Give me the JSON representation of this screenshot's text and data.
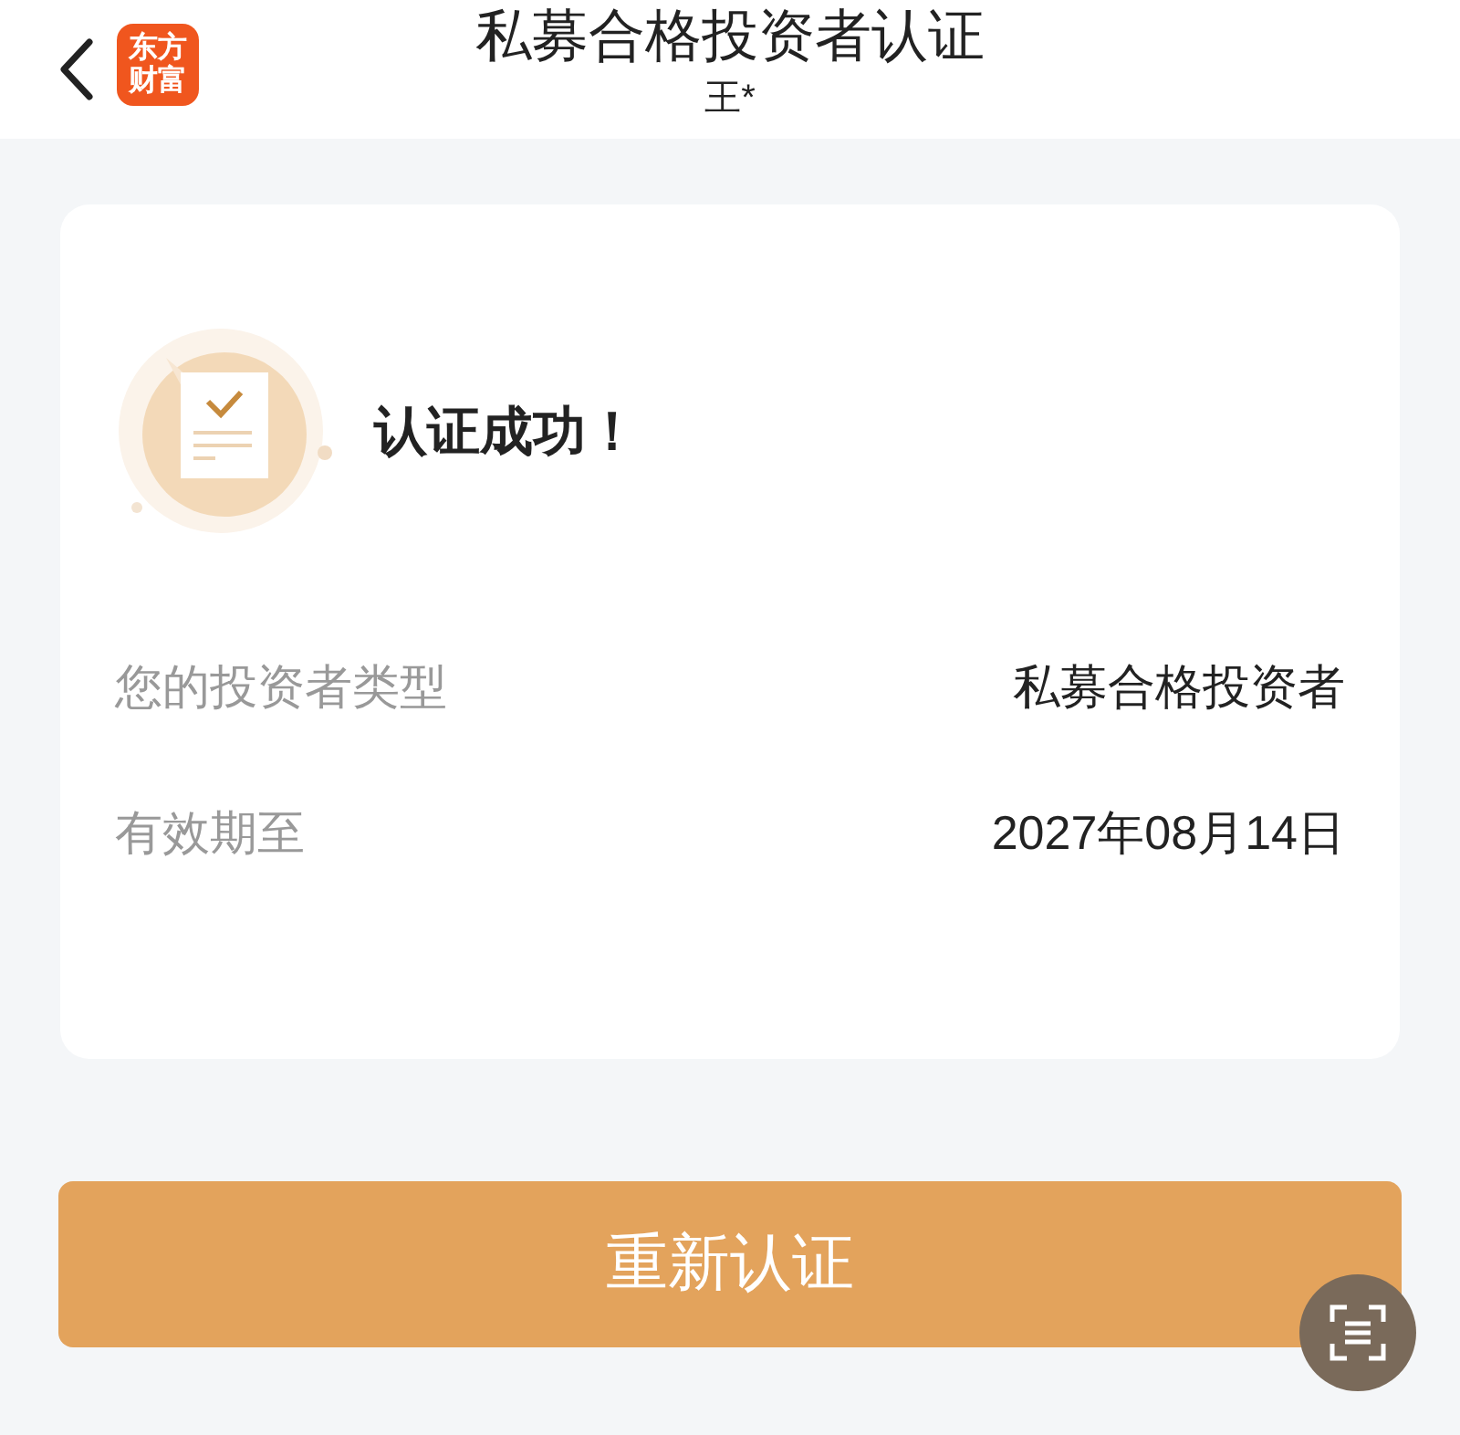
{
  "header": {
    "logo": "东方财富",
    "title": "私募合格投资者认证",
    "subtitle": "王*"
  },
  "result": {
    "message": "认证成功！"
  },
  "fields": [
    {
      "label": "您的投资者类型",
      "value": "私募合格投资者"
    },
    {
      "label": "有效期至",
      "value": "2027年08月14日"
    }
  ],
  "button": "重新认证"
}
